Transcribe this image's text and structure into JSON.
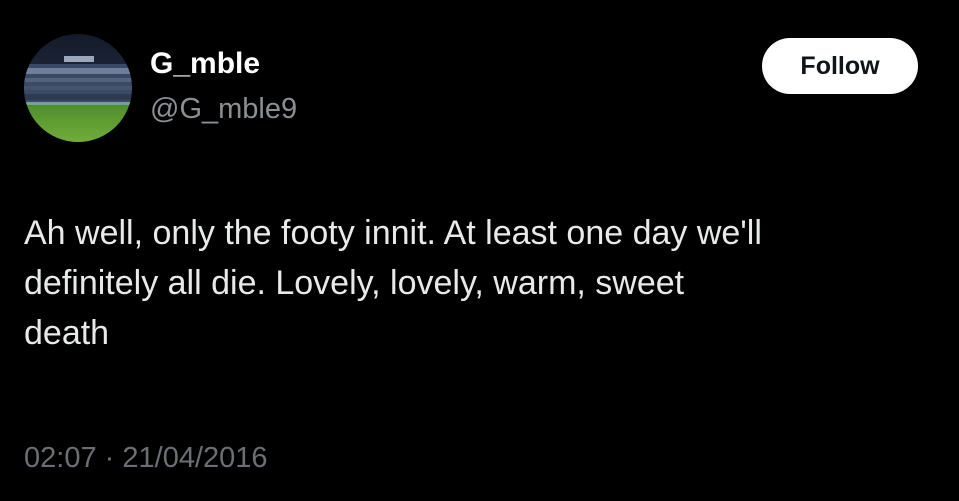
{
  "user": {
    "display_name": "G_mble",
    "handle": "@G_mble9",
    "avatar_icon": "football-stadium-avatar"
  },
  "actions": {
    "follow_label": "Follow"
  },
  "tweet": {
    "text": "Ah well, only the footy innit. At least one day we'll\ndefinitely all die. Lovely, lovely, warm, sweet\ndeath",
    "time": "02:07",
    "separator": "·",
    "date": "21/04/2016"
  },
  "colors": {
    "background": "#000000",
    "text": "#e7e9ea",
    "muted": "#8b8f94",
    "button_bg": "#ffffff",
    "button_text": "#0f1419"
  }
}
